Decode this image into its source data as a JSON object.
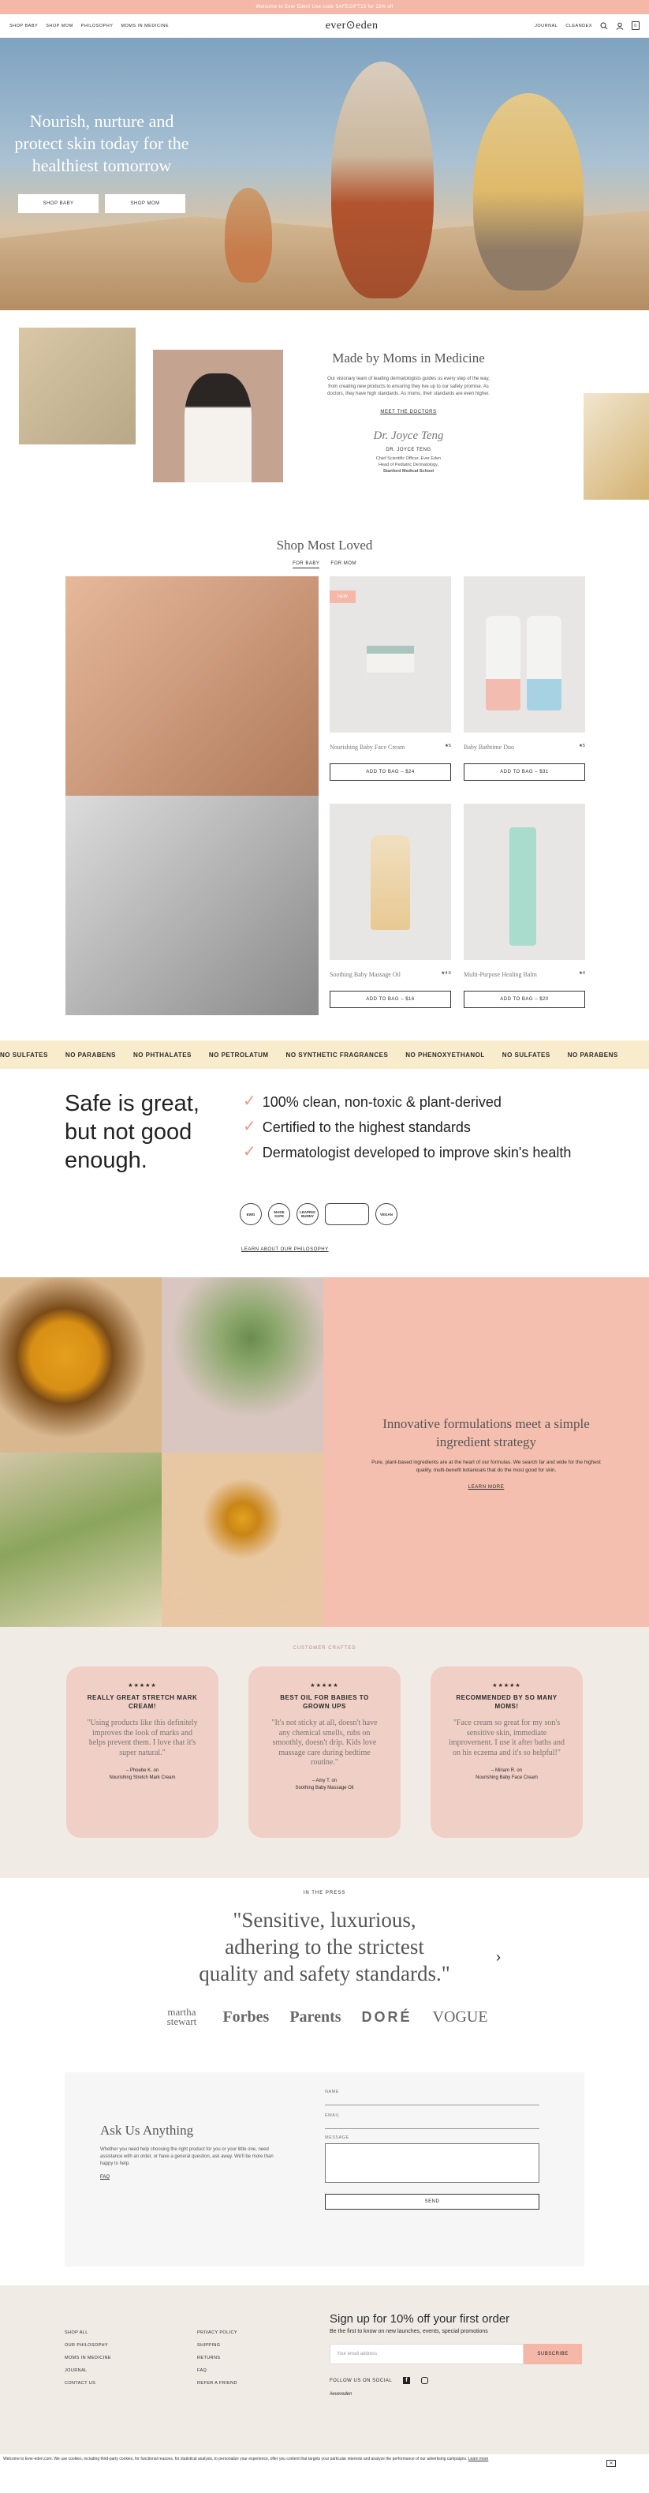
{
  "promo": {
    "text": "Welcome to Ever Eden! Use code SAFEGIFT15 for 15% off"
  },
  "nav": {
    "left": [
      "SHOP BABY",
      "SHOP MOM",
      "PHILOSOPHY",
      "MOMS IN MEDICINE"
    ],
    "logo": "ever⊙eden",
    "right": [
      "JOURNAL",
      "CLEANDEX"
    ],
    "cart_count": "0"
  },
  "hero": {
    "title": "Nourish, nurture and protect skin today for the healthiest tomorrow",
    "btn_baby": "SHOP BABY",
    "btn_mom": "SHOP MOM"
  },
  "moms": {
    "title": "Made by Moms in Medicine",
    "body": "Our visionary team of leading dermatologists guides us every step of the way, from creating new products to ensuring they live up to our safety promise. As doctors, they have high standards. As moms, their standards are even higher.",
    "link": "MEET THE DOCTORS",
    "signature": "Dr. Joyce Teng",
    "dr_name": "DR. JOYCE TENG",
    "dr_role1": "Chief Scientific Officer, Ever Eden",
    "dr_role2": "Head of Pediatric Dermatology,",
    "dr_role3": "Stanford Medical School"
  },
  "loved": {
    "title": "Shop Most Loved",
    "tab_baby": "FOR BABY",
    "tab_mom": "FOR MOM",
    "products": [
      {
        "name": "Nourishing Baby Face Cream",
        "rating": "★5",
        "btn": "ADD TO BAG – $24",
        "badge": "NEW"
      },
      {
        "name": "Baby Bathtime Duo",
        "rating": "★5",
        "btn": "ADD TO BAG – $31",
        "badge": ""
      },
      {
        "name": "Soothing Baby Massage Oil",
        "rating": "★4.6",
        "btn": "ADD TO BAG – $16",
        "badge": ""
      },
      {
        "name": "Multi-Purpose Healing Balm",
        "rating": "★4",
        "btn": "ADD TO BAG – $20",
        "badge": ""
      }
    ]
  },
  "marquee": [
    "NO SULFATES",
    "NO PARABENS",
    "NO PHTHALATES",
    "NO PETROLATUM",
    "NO SYNTHETIC FRAGRANCES",
    "NO PHENOXYETHANOL",
    "NO SULFATES",
    "NO PARABENS"
  ],
  "safe": {
    "title": "Safe is great, but not good enough.",
    "items": [
      "100% clean, non-toxic & plant-derived",
      "Certified to the highest standards",
      "Dermatologist developed to improve skin's health"
    ],
    "certs": [
      "EWG",
      "MADE SAFE",
      "LEAPING BUNNY",
      "",
      "VEGAN"
    ],
    "link": "LEARN ABOUT OUR PHILOSOPHY"
  },
  "innov": {
    "title": "Innovative formulations meet a simple ingredient strategy",
    "body": "Pure, plant-based ingredients are at the heart of our formulas. We search far and wide for the highest quality, multi-benefit botanicals that do the most good for skin.",
    "link": "LEARN MORE"
  },
  "reviews": {
    "label": "CUSTOMER CRAFTED",
    "items": [
      {
        "stars": "★★★★★",
        "head": "REALLY GREAT STRETCH MARK CREAM!",
        "quote": "\"Using products like this definitely improves the look of marks and helps prevent them. I love that it's super natural.\"",
        "author": "– Phoebe K. on",
        "product": "Nourishing Stretch Mark Cream"
      },
      {
        "stars": "★★★★★",
        "head": "BEST OIL FOR BABIES TO GROWN UPS",
        "quote": "\"It's not sticky at all, doesn't have any chemical smells, rubs on smoothly, doesn't drip. Kids love massage care during bedtime routine.\"",
        "author": "– Amy T. on",
        "product": "Soothing Baby Massage Oil"
      },
      {
        "stars": "★★★★★",
        "head": "RECOMMENDED BY SO MANY MOMS!",
        "quote": "\"Face cream so great for my son's sensitive skin, immediate improvement. I use it after baths and on his eczema and it's so helpful!\"",
        "author": "– Miriam R. on",
        "product": "Nourishing Baby Face Cream"
      }
    ]
  },
  "press": {
    "label": "IN THE PRESS",
    "quote": "\"Sensitive, luxurious, adhering to the strictest quality and safety standards.\"",
    "logos": [
      "martha stewart",
      "Forbes",
      "Parents",
      "DORÉ",
      "VOGUE"
    ]
  },
  "ask": {
    "title": "Ask Us Anything",
    "body": "Whether you need help choosing the right product for you or your little one, need assistance with an order, or have a general question, ask away. We'll be more than happy to help.",
    "faq": "FAQ",
    "name_label": "NAME",
    "email_label": "EMAIL",
    "message_label": "MESSAGE",
    "send": "SEND"
  },
  "footer": {
    "col1": [
      "SHOP ALL",
      "OUR PHILOSOPHY",
      "MOMS IN MEDICINE",
      "JOURNAL",
      "CONTACT US"
    ],
    "col2": [
      "PRIVACY POLICY",
      "SHIPPING",
      "RETURNS",
      "FAQ",
      "REFER A FRIEND"
    ],
    "news_title": "Sign up for 10% off your first order",
    "news_sub": "Be the first to know on new launches, events, special promotions",
    "news_placeholder": "Your email address",
    "news_btn": "SUBSCRIBE",
    "social_label": "FOLLOW US ON SOCIAL",
    "hashtag": "#evereden"
  },
  "cookie": {
    "text": "Welcome to Ever-eden.com. We use cookies, including third-party cookies, for functional reasons, for statistical analysis, to personalize your experience, offer you content that targets your particular interests and analyze the performance of our advertising campaigns.",
    "link": "Learn more"
  }
}
